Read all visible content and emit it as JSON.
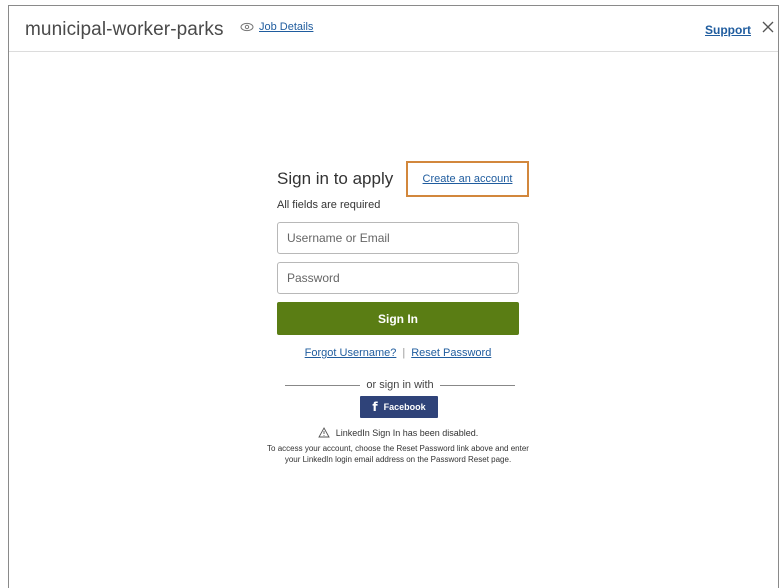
{
  "header": {
    "app_title": "municipal-worker-parks",
    "job_details_label": "Job Details",
    "support_label": "Support",
    "close_glyph": "✕"
  },
  "signin": {
    "title": "Sign in to apply",
    "create_account_label": "Create an account",
    "required_note": "All fields are required",
    "username_placeholder": "Username or Email",
    "username_value": "",
    "password_placeholder": "Password",
    "password_value": "",
    "signin_button_label": "Sign In",
    "forgot_username_label": "Forgot Username?",
    "links_separator": "|",
    "reset_password_label": "Reset Password",
    "or_sign_in_with": "or sign in with",
    "facebook_glyph": "f",
    "facebook_label": "Facebook",
    "linkedin_disabled": "LinkedIn Sign In has been disabled.",
    "linkedin_info": "To access your account, choose the Reset Password link above and enter your LinkedIn login email address on the Password Reset page."
  },
  "icons": {
    "job_details": "eye-icon",
    "support_close": "close-icon",
    "facebook": "facebook-icon",
    "linkedin_notice": "warning-icon"
  },
  "colors": {
    "link": "#1f5c9e",
    "signin_button": "#5a7d14",
    "facebook_button": "#2f4379",
    "highlight_border": "#d2873c"
  }
}
